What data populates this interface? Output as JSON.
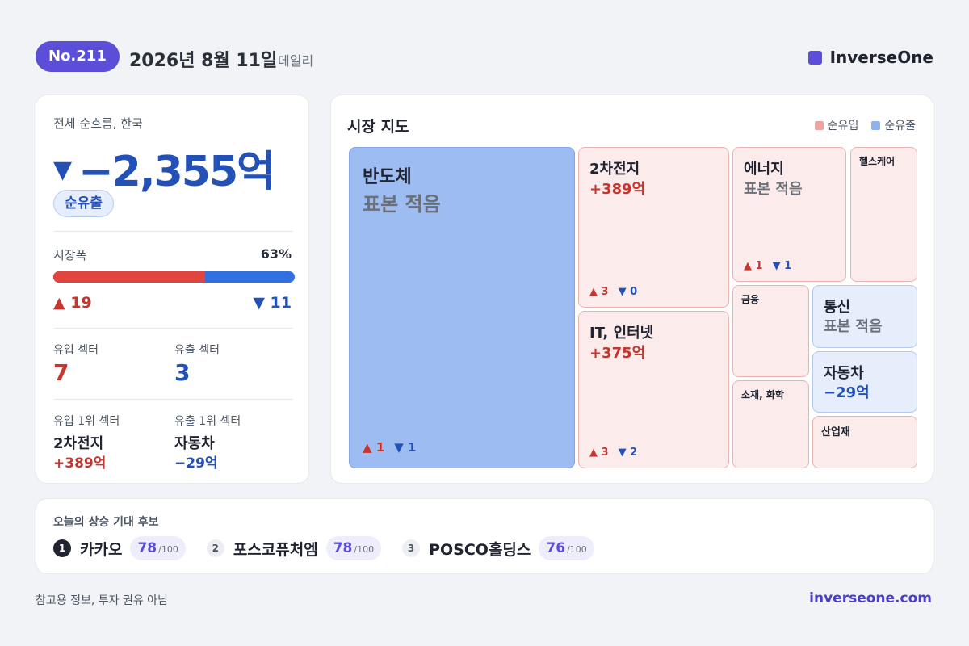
{
  "header": {
    "issue": "No.211",
    "date": "2026년 8월 11일",
    "edition": "데일리",
    "brand": "InverseOne",
    "brand_color": "#5b4fd9"
  },
  "summary": {
    "title": "전체 순흐름, 한국",
    "arrow": "▼",
    "net_flow": "−2,355억",
    "flow_badge": "순유출",
    "breadth_label": "시장폭",
    "breadth_pct_text": "63%",
    "breadth_fraction": 0.63,
    "advancers": "▲ 19",
    "decliners": "▼ 11",
    "inflow_sectors_label": "유입 섹터",
    "inflow_sectors": "7",
    "outflow_sectors_label": "유출 섹터",
    "outflow_sectors": "3",
    "top_inflow_label": "유입 1위 섹터",
    "top_inflow_name": "2차전지",
    "top_inflow_amount": "+389억",
    "top_outflow_label": "유출 1위 섹터",
    "top_outflow_name": "자동차",
    "top_outflow_amount": "−29억"
  },
  "market_map": {
    "title": "시장 지도",
    "legend": {
      "inflow": "순유입",
      "outflow": "순유출",
      "inflow_color": "#eea3a0",
      "outflow_color": "#8fb2ee"
    },
    "tiles": [
      {
        "name": "반도체",
        "value": "표본 적음",
        "up": "▲ 1",
        "down": "▼ 1",
        "flow": "outflow"
      },
      {
        "name": "2차전지",
        "value": "+389억",
        "up": "▲ 3",
        "down": "▼ 0",
        "flow": "inflow"
      },
      {
        "name": "IT, 인터넷",
        "value": "+375억",
        "up": "▲ 3",
        "down": "▼ 2",
        "flow": "inflow"
      },
      {
        "name": "에너지",
        "value": "표본 적음",
        "up": "▲ 1",
        "down": "▼ 1",
        "flow": "inflow"
      },
      {
        "name": "헬스케어",
        "flow": "inflow"
      },
      {
        "name": "금융",
        "flow": "inflow"
      },
      {
        "name": "통신",
        "value": "표본 적음",
        "flow": "outflow"
      },
      {
        "name": "자동차",
        "value": "−29억",
        "flow": "outflow"
      },
      {
        "name": "소재, 화학",
        "flow": "inflow"
      },
      {
        "name": "산업재",
        "flow": "inflow"
      }
    ]
  },
  "candidates": {
    "title": "오늘의 상승 기대 후보",
    "max_label": "/100",
    "items": [
      {
        "rank": "1",
        "name": "카카오",
        "score": "78"
      },
      {
        "rank": "2",
        "name": "포스코퓨처엠",
        "score": "78"
      },
      {
        "rank": "3",
        "name": "POSCO홀딩스",
        "score": "76"
      }
    ]
  },
  "footer": {
    "disclaimer": "참고용 정보, 투자 권유 아님",
    "site": "inverseone.com"
  }
}
